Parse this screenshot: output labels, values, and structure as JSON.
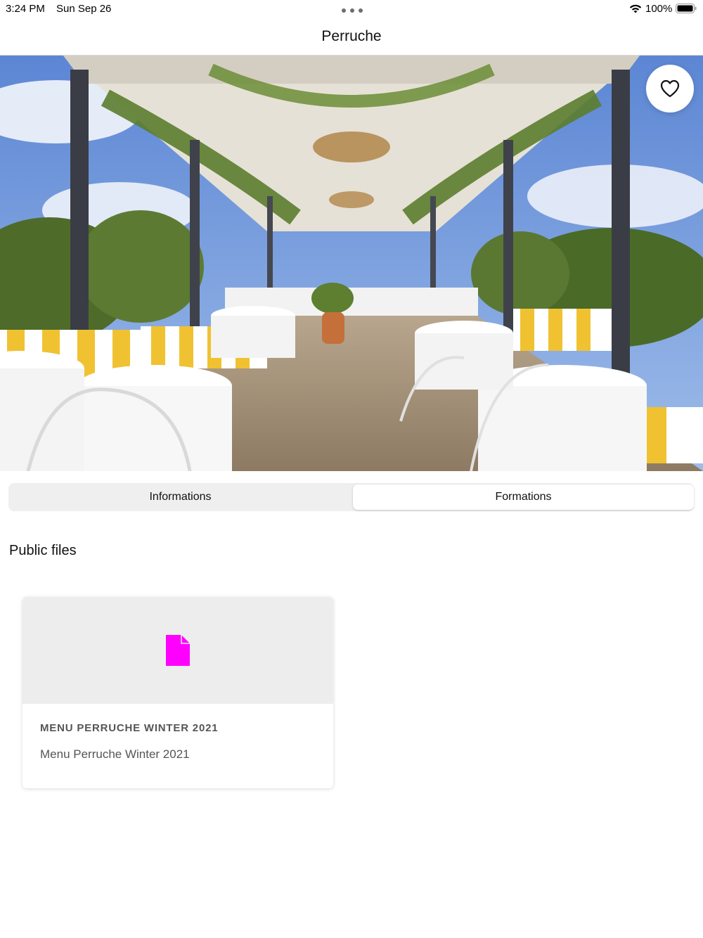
{
  "status_bar": {
    "time": "3:24 PM",
    "date": "Sun Sep 26",
    "battery": "100%",
    "icons": [
      "more-dots-icon",
      "wifi-icon",
      "battery-icon"
    ]
  },
  "nav": {
    "title": "Perruche"
  },
  "hero": {
    "favorite_icon": "heart-outline-icon"
  },
  "tabs": [
    {
      "label": "Informations",
      "selected": false
    },
    {
      "label": "Formations",
      "selected": true
    }
  ],
  "section": {
    "title": "Public files"
  },
  "files": [
    {
      "title": "MENU PERRUCHE WINTER 2021",
      "description": "Menu Perruche Winter 2021",
      "icon": "document-icon",
      "icon_color": "#ff00ff"
    }
  ],
  "colors": {
    "accent_file": "#ff00ff",
    "segment_bg": "#efefef"
  }
}
